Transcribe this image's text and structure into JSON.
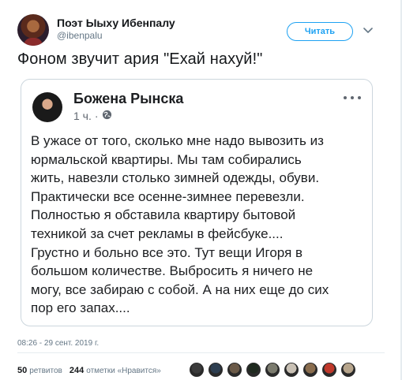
{
  "author": {
    "name": "Поэт Ыыху Ибенпалу",
    "handle": "@ibenpalu"
  },
  "follow_button": "Читать",
  "tweet_text": "Фоном звучит ария \"Ехай нахуй!\"",
  "embedded_post": {
    "name": "Божена Рынска",
    "time": "1 ч.",
    "separator": "·",
    "lines": [
      "В ужасе от того, сколько мне надо вывозить из",
      "юрмальской квартиры. Мы там собирались",
      "жить, навезли столько зимней одежды, обуви.",
      "Практически все осенне-зимнее перевезли.",
      "Полностью я обставила квартиру бытовой",
      "техникой за счет рекламы в фейсбуке....",
      "Грустно и больно все это. Тут вещи Игоря в",
      "большом количестве. Выбросить я ничего не",
      "могу, все забираю с собой. А на них еще до сих",
      "пор его запах...."
    ]
  },
  "timestamp": "08:26 - 29 сент. 2019 г.",
  "stats": {
    "retweets_count": "50",
    "retweets_label": "ретвитов",
    "likes_count": "244",
    "likes_label": "отметки «Нравится»"
  },
  "liker_colors": [
    "#3b3b3b",
    "#2d3e50",
    "#6b5a48",
    "#1f2a1f",
    "#7b7b6e",
    "#c9c1b5",
    "#8a6d4e",
    "#c0392b",
    "#b7a58c"
  ],
  "colors": {
    "accent": "#1da1f2",
    "text": "#14171a",
    "muted": "#657786",
    "border": "#ccd6dd"
  }
}
